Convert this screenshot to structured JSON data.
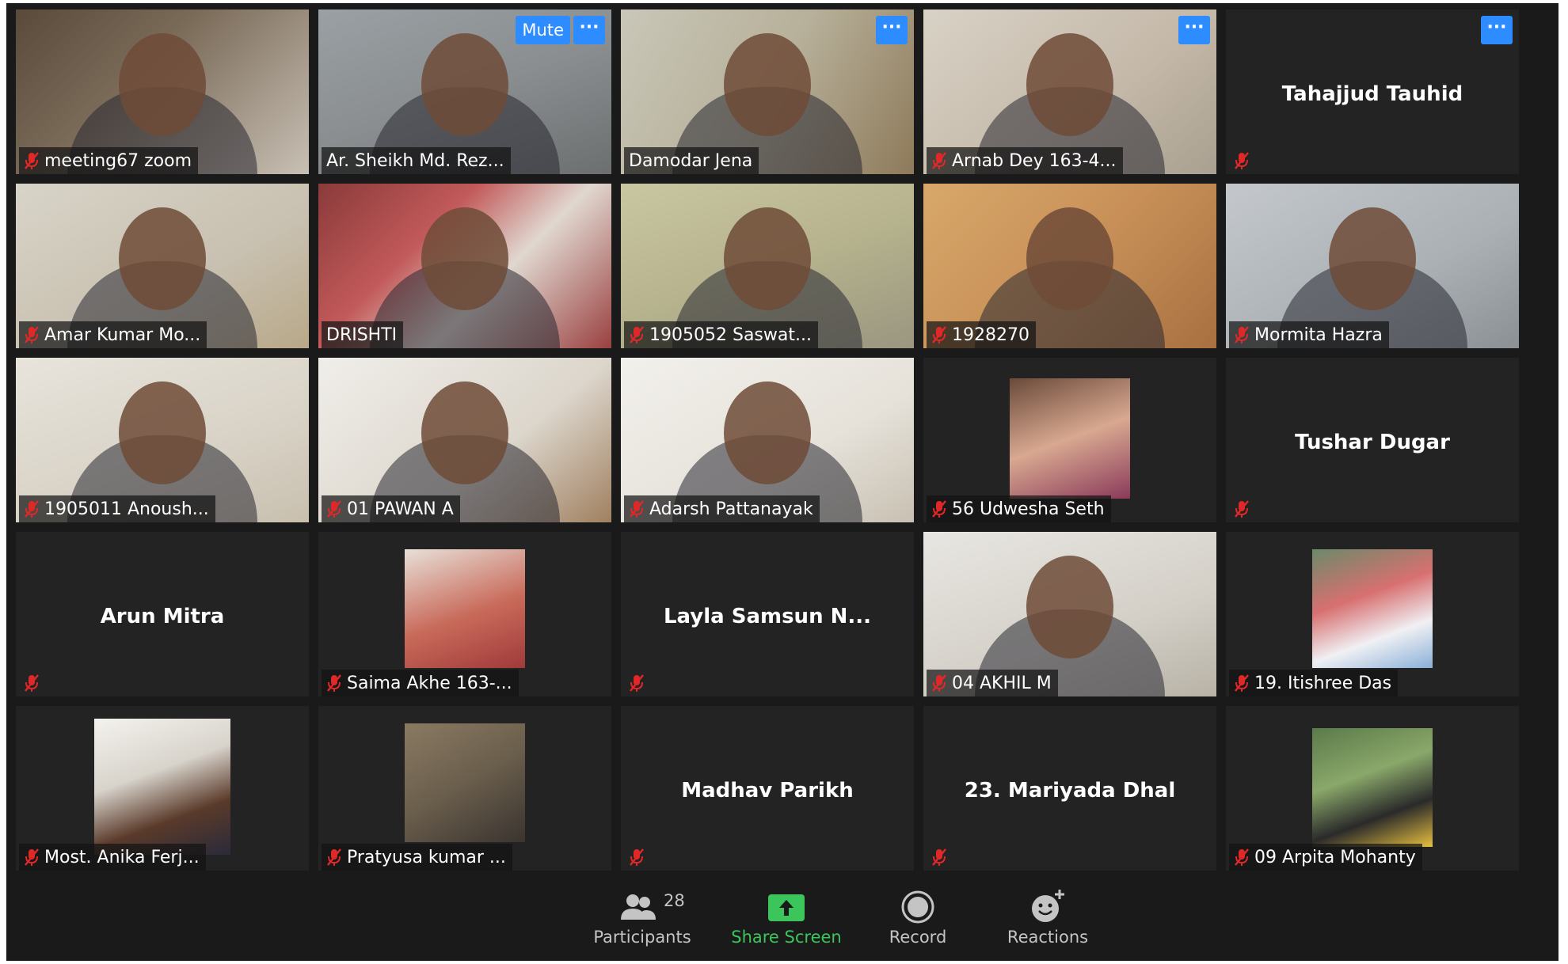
{
  "participants": [
    {
      "name": "meeting67 zoom",
      "muted": true,
      "video": "v1"
    },
    {
      "name": "Ar. Sheikh Md. Rez...",
      "muted": false,
      "video": "v2",
      "mute_button": "Mute",
      "more": "···"
    },
    {
      "name": "Damodar Jena",
      "muted": false,
      "video": "v3",
      "active": true,
      "more": "···"
    },
    {
      "name": "Arnab Dey 163-4...",
      "muted": true,
      "video": "v4",
      "more": "···"
    },
    {
      "name": "Tahajjud Tauhid",
      "muted": true,
      "center": true,
      "more": "···"
    },
    {
      "name": "Amar Kumar Mo...",
      "muted": true,
      "video": "v6"
    },
    {
      "name": "DRISHTI",
      "muted": false,
      "video": "v7"
    },
    {
      "name": "1905052 Saswat...",
      "muted": true,
      "video": "v8"
    },
    {
      "name": "1928270",
      "muted": true,
      "video": "v9"
    },
    {
      "name": "Mormita Hazra",
      "muted": true,
      "video": "v10"
    },
    {
      "name": "1905011 Anoush...",
      "muted": true,
      "video": "v11"
    },
    {
      "name": "01 PAWAN A",
      "muted": true,
      "video": "v12"
    },
    {
      "name": "Adarsh Pattanayak",
      "muted": true,
      "video": "v13"
    },
    {
      "name": "56 Udwesha Seth",
      "muted": true,
      "photo": "p08"
    },
    {
      "name": "Tushar Dugar",
      "muted": true,
      "center": true
    },
    {
      "name": "Arun Mitra",
      "muted": true,
      "center": true
    },
    {
      "name": "Saima Akhe 163-...",
      "muted": true,
      "photo": "p14"
    },
    {
      "name": "Layla Samsun N...",
      "muted": true,
      "center": true
    },
    {
      "name": "04 AKHIL M",
      "muted": true,
      "video": "v19"
    },
    {
      "name": "19. Itishree Das",
      "muted": true,
      "photo": "p15"
    },
    {
      "name": "Most. Anika Ferj...",
      "muted": true,
      "photo": "p16"
    },
    {
      "name": "Pratyusa kumar ...",
      "muted": true,
      "photo": "p17"
    },
    {
      "name": "Madhav Parikh",
      "muted": true,
      "center": true
    },
    {
      "name": "23. Mariyada Dhal",
      "muted": true,
      "center": true
    },
    {
      "name": "09 Arpita Mohanty",
      "muted": true,
      "photo": "p20"
    }
  ],
  "toolbar": {
    "participants_count": "28",
    "participants_label": "Participants",
    "share_label": "Share Screen",
    "record_label": "Record",
    "reactions_label": "Reactions"
  },
  "colors": {
    "accent": "#2d8cff",
    "active_speaker": "#e6e25a",
    "share_green": "#3bc55a",
    "muted_red": "#e02828"
  }
}
